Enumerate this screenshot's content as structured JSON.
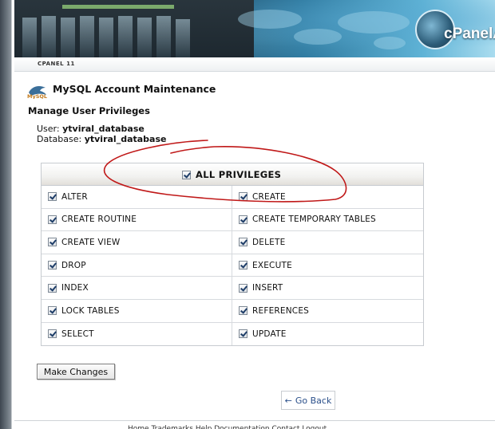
{
  "header": {
    "brand": "cPanel",
    "brand_suffix": "Ag",
    "version_label": "CPANEL 11"
  },
  "page": {
    "title": "MySQL Account Maintenance",
    "section_title": "Manage User Privileges",
    "user_label": "User:",
    "user_value": "ytviral_database",
    "database_label": "Database:",
    "database_value": "ytviral_database"
  },
  "privileges": {
    "all_label": "ALL PRIVILEGES",
    "all_checked": true,
    "rows": [
      {
        "left": "ALTER",
        "right": "CREATE"
      },
      {
        "left": "CREATE ROUTINE",
        "right": "CREATE TEMPORARY TABLES"
      },
      {
        "left": "CREATE VIEW",
        "right": "DELETE"
      },
      {
        "left": "DROP",
        "right": "EXECUTE"
      },
      {
        "left": "INDEX",
        "right": "INSERT"
      },
      {
        "left": "LOCK TABLES",
        "right": "REFERENCES"
      },
      {
        "left": "SELECT",
        "right": "UPDATE"
      }
    ]
  },
  "actions": {
    "make_changes_label": "Make Changes",
    "go_back_label": "Go Back",
    "go_back_arrow": "←"
  },
  "footer": {
    "links_text": "Home  Trademarks  Help  Documentation  Contact  Logout"
  },
  "colors": {
    "annotation": "#c01818",
    "checkmark": "#1e3d68"
  }
}
